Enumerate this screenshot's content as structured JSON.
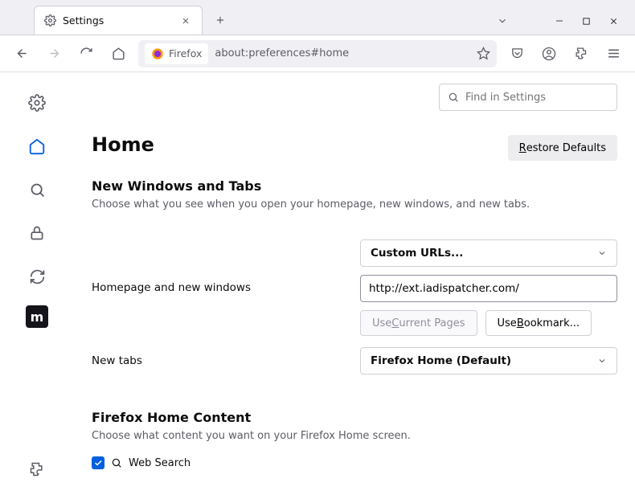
{
  "tab": {
    "title": "Settings"
  },
  "urlbar": {
    "identity": "Firefox",
    "url": "about:preferences#home"
  },
  "search": {
    "placeholder": "Find in Settings"
  },
  "page": {
    "title": "Home",
    "restore": "estore Defaults"
  },
  "section1": {
    "title": "New Windows and Tabs",
    "desc": "Choose what you see when you open your homepage, new windows, and new tabs."
  },
  "homepage": {
    "label": "Homepage and new windows",
    "select": "Custom URLs...",
    "value": "http://ext.iadispatcher.com/",
    "useCurrent": "urrent Pages",
    "useBookmark": "ookmark..."
  },
  "newtabs": {
    "label": "New tabs",
    "select": "Firefox Home (Default)"
  },
  "section2": {
    "title": "Firefox Home Content",
    "desc": "Choose what content you want on your Firefox Home screen.",
    "websearch": "Web Search"
  }
}
